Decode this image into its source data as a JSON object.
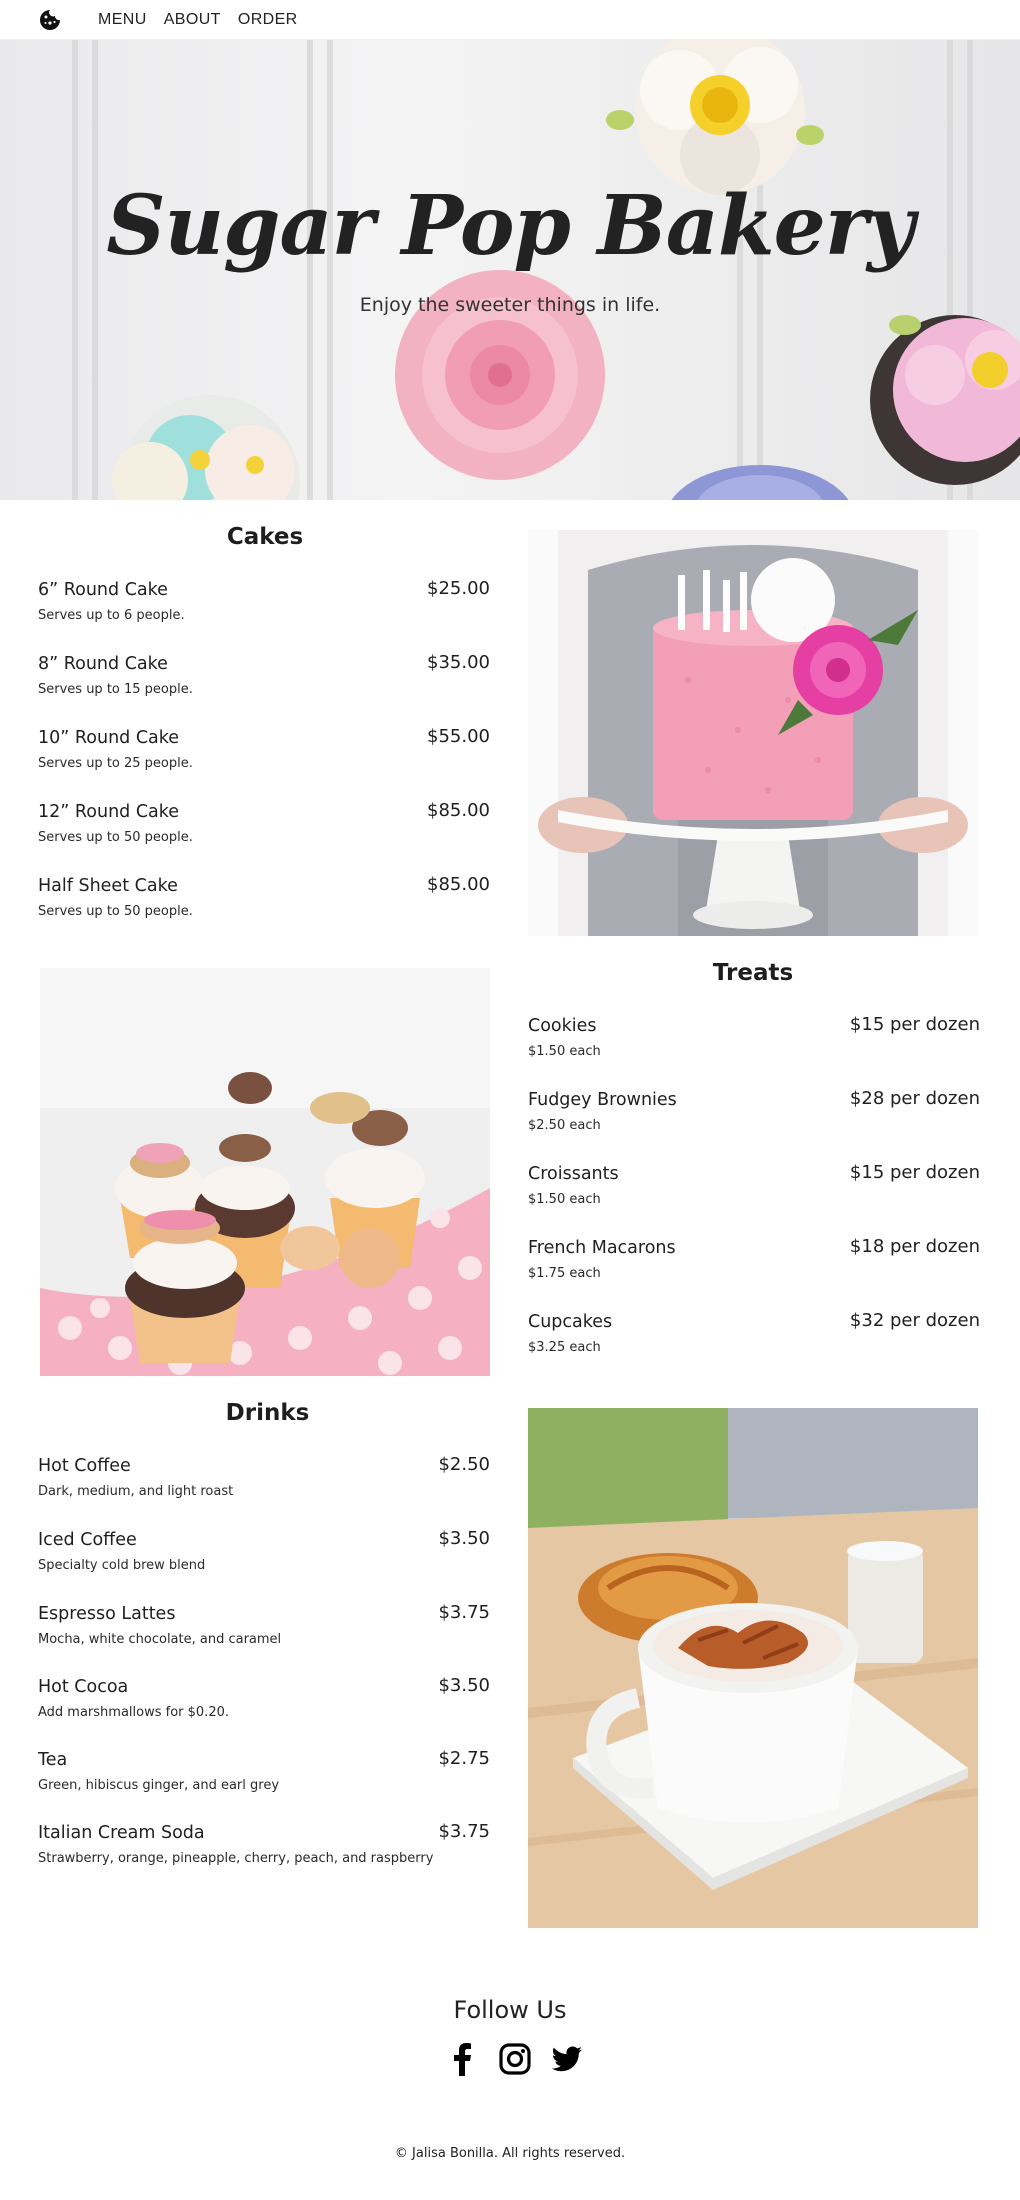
{
  "nav": {
    "logo_icon": "cookie-icon",
    "links": [
      "MENU",
      "ABOUT",
      "ORDER"
    ]
  },
  "hero": {
    "title": "Sugar Pop Bakery",
    "tagline": "Enjoy the sweeter things in life."
  },
  "cakes": {
    "title": "Cakes",
    "items": [
      {
        "name": "6” Round Cake",
        "desc": "Serves up to 6 people.",
        "price": "$25.00"
      },
      {
        "name": "8” Round Cake",
        "desc": "Serves up to 15 people.",
        "price": "$35.00"
      },
      {
        "name": "10” Round Cake",
        "desc": "Serves up to 25 people.",
        "price": "$55.00"
      },
      {
        "name": "12” Round Cake",
        "desc": "Serves up to 50 people.",
        "price": "$85.00"
      },
      {
        "name": "Half Sheet Cake",
        "desc": "Serves up to 50 people.",
        "price": "$85.00"
      }
    ]
  },
  "treats": {
    "title": "Treats",
    "items": [
      {
        "name": "Cookies",
        "desc": "$1.50 each",
        "price": "$15 per dozen"
      },
      {
        "name": "Fudgey Brownies",
        "desc": "$2.50 each",
        "price": "$28 per dozen"
      },
      {
        "name": "Croissants",
        "desc": "$1.50 each",
        "price": "$15 per dozen"
      },
      {
        "name": "French Macarons",
        "desc": "$1.75 each",
        "price": "$18 per dozen"
      },
      {
        "name": "Cupcakes",
        "desc": "$3.25 each",
        "price": "$32 per dozen"
      }
    ]
  },
  "drinks": {
    "title": "Drinks",
    "items": [
      {
        "name": "Hot Coffee",
        "desc": "Dark, medium, and light roast",
        "price": "$2.50"
      },
      {
        "name": "Iced Coffee",
        "desc": "Specialty cold brew blend",
        "price": "$3.50"
      },
      {
        "name": "Espresso Lattes",
        "desc": "Mocha, white chocolate, and caramel",
        "price": "$3.75"
      },
      {
        "name": "Hot Cocoa",
        "desc": "Add marshmallows for $0.20.",
        "price": "$3.50"
      },
      {
        "name": "Tea",
        "desc": "Green, hibiscus ginger, and earl grey",
        "price": "$2.75"
      },
      {
        "name": "Italian Cream Soda",
        "desc": "Strawberry, orange, pineapple, cherry, peach, and raspberry",
        "price": "$3.75"
      }
    ]
  },
  "footer": {
    "follow_title": "Follow Us",
    "socials": [
      "facebook-icon",
      "instagram-icon",
      "twitter-icon"
    ],
    "copyright": "© Jalisa Bonilla. All rights reserved."
  },
  "colors": {
    "text": "#1f1f1f",
    "pink_frosting": "#f4a9bf",
    "hero_bg": "#eeeeef"
  }
}
